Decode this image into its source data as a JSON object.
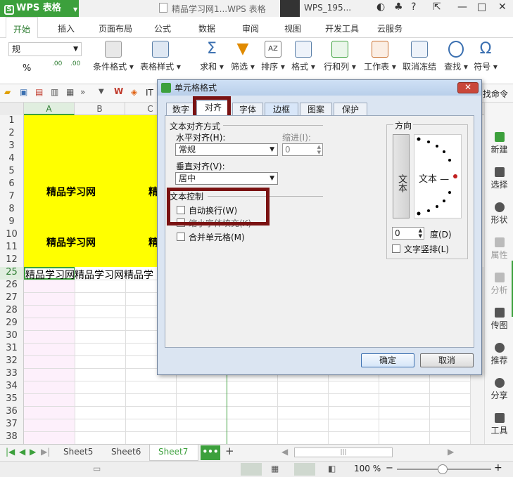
{
  "app": {
    "name": "WPS 表格",
    "doc_title": "精品学习网1...WPS 表格",
    "user": "WPS_195..."
  },
  "ribbon_tabs": [
    "开始",
    "插入",
    "页面布局",
    "公式",
    "数据",
    "审阅",
    "视图",
    "开发工具",
    "云服务"
  ],
  "ribbon": {
    "number_format": "规",
    "percent": "%",
    "buttons": [
      "条件格式",
      "表格样式",
      "求和",
      "筛选",
      "排序",
      "格式",
      "行和列",
      "工作表",
      "取消冻结",
      "查找",
      "符号"
    ]
  },
  "qat": {
    "find_cmd": "找命令",
    "it_label": "IT"
  },
  "columns": [
    "A",
    "B",
    "C"
  ],
  "rows": [
    "1",
    "2",
    "3",
    "4",
    "5",
    "6",
    "7",
    "8",
    "9",
    "10",
    "11",
    "12",
    "25",
    "26",
    "27",
    "28",
    "29",
    "30",
    "31",
    "32",
    "33",
    "34",
    "35",
    "36",
    "37",
    "38"
  ],
  "cells": {
    "a6": "精品学习网",
    "a10": "精品学习网",
    "c6": "精",
    "c10": "精",
    "row25": "精品学习网精品学习网精品学"
  },
  "side_panel": [
    "新建",
    "选择",
    "形状",
    "属性",
    "分析",
    "传图",
    "推荐",
    "分享",
    "工具"
  ],
  "sheets": [
    "Sheet5",
    "Sheet6",
    "Sheet7"
  ],
  "active_sheet": "Sheet7",
  "status": {
    "zoom": "100 %"
  },
  "dialog": {
    "title": "单元格格式",
    "tabs": [
      "数字",
      "对齐",
      "字体",
      "边框",
      "图案",
      "保护"
    ],
    "active_tab": "对齐",
    "section_align": "文本对齐方式",
    "h_align_label": "水平对齐(H):",
    "h_align_value": "常规",
    "indent_label": "缩进(I):",
    "indent_value": "0",
    "v_align_label": "垂直对齐(V):",
    "v_align_value": "居中",
    "section_control": "文本控制",
    "wrap_label": "自动换行(W)",
    "shrink_label": "缩小字体填充(K)",
    "merge_label": "合并单元格(M)",
    "orientation_label": "方向",
    "vertical_text": "文本",
    "dial_text": "文本 —",
    "degrees_value": "0",
    "degrees_label": "度(D)",
    "stack_label": "文字竖排(L)",
    "ok": "确定",
    "cancel": "取消"
  },
  "colors": {
    "accent": "#3ca03c",
    "highlight": "#7a1212",
    "cell_fill": "#ffff00"
  }
}
